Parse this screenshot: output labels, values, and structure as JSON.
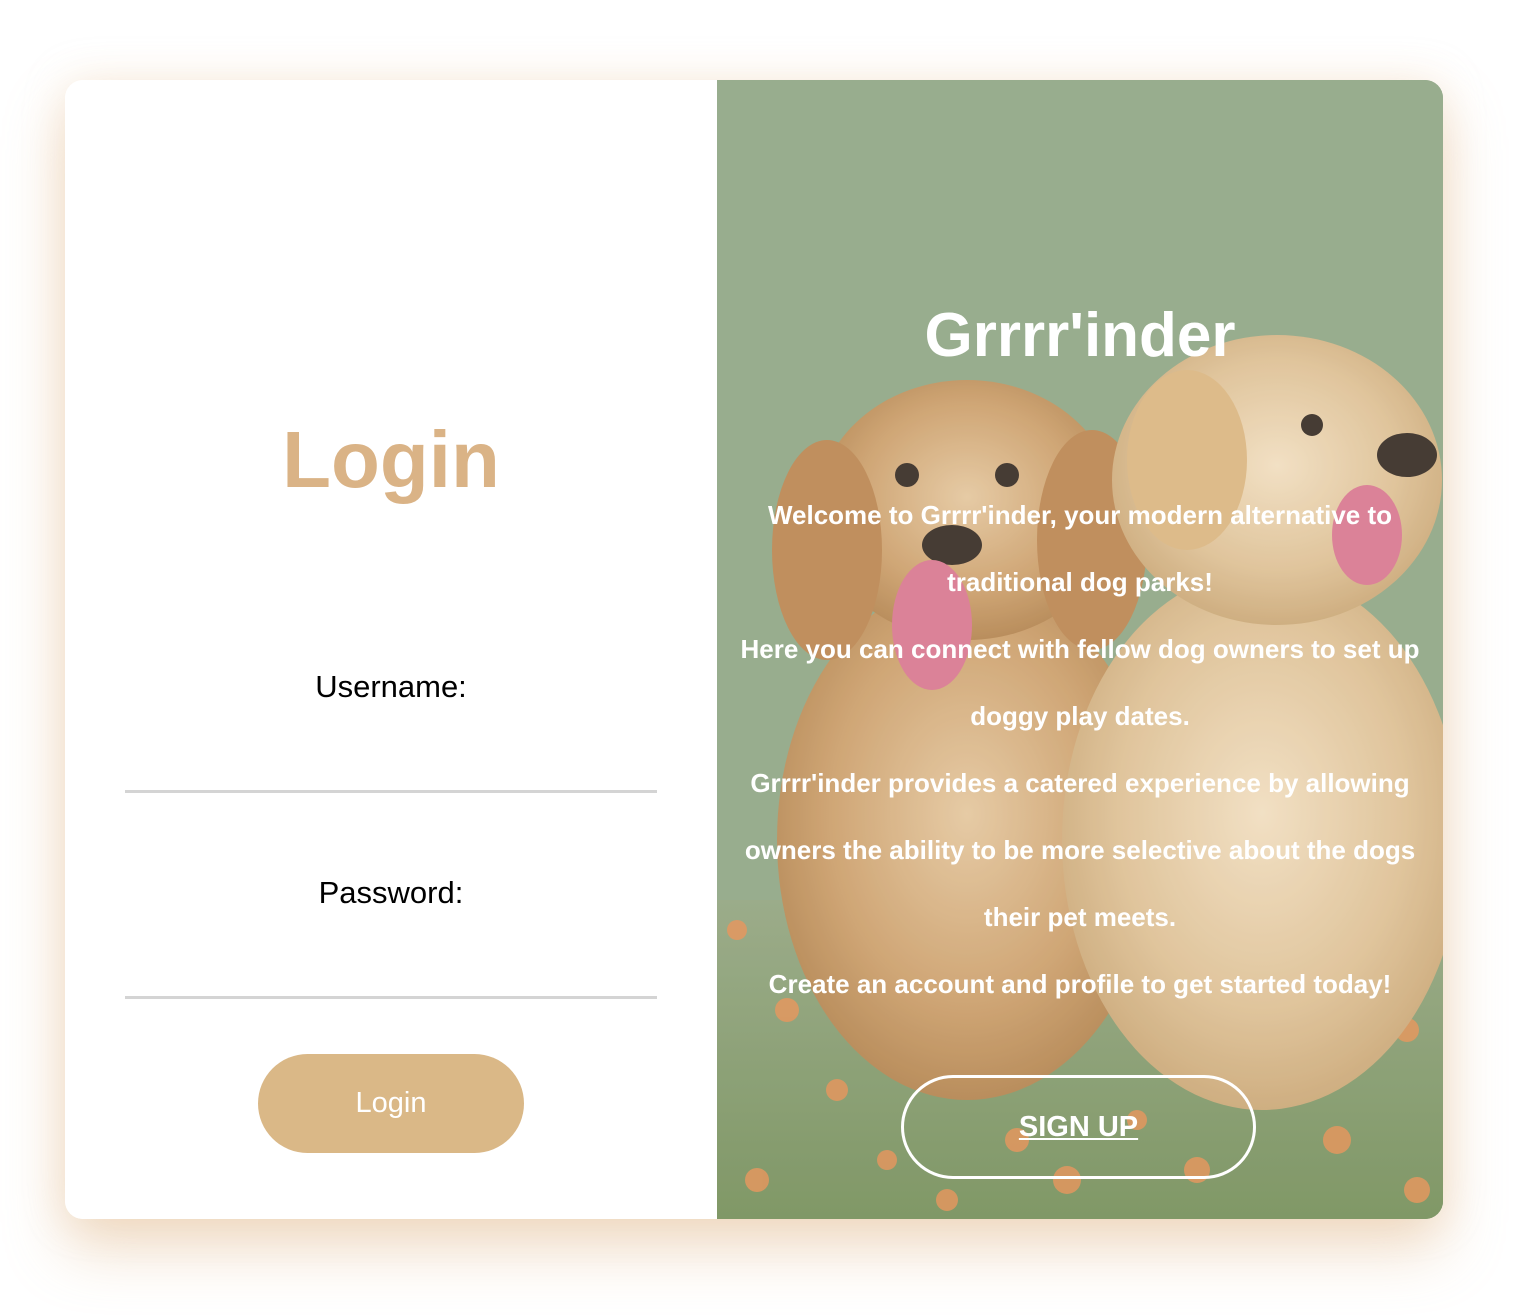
{
  "login": {
    "title": "Login",
    "username_label": "Username:",
    "username_value": "",
    "password_label": "Password:",
    "password_value": "",
    "button_label": "Login"
  },
  "welcome": {
    "title": "Grrrr'inder",
    "paragraphs": [
      "Welcome to Grrrr'inder, your modern alternative to traditional dog parks!",
      "Here you can connect with fellow dog owners to set up doggy play dates.",
      "Grrrr'inder provides a catered experience by allowing owners the ability to be more selective about the dogs their pet meets.",
      "Create an account and profile to get started today!"
    ],
    "signup_label": "SIGN UP",
    "background_image": "puppies-photo"
  },
  "colors": {
    "accent": "#dab386",
    "button": "#dab887",
    "input_underline": "#d4d4d4"
  }
}
